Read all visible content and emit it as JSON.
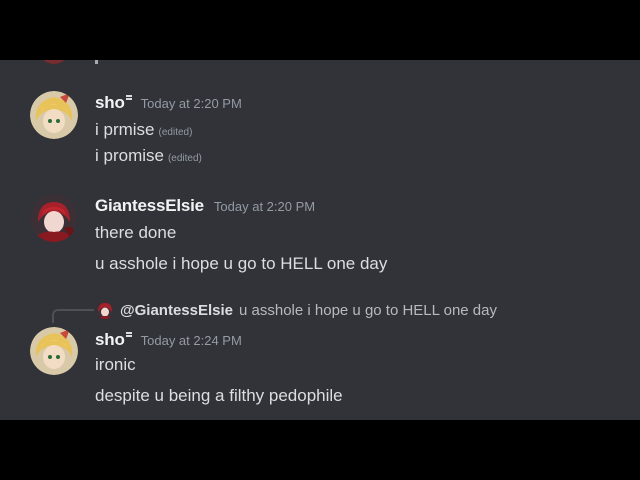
{
  "messages": [
    {
      "author": "sho",
      "timestamp": "Today at 2:20 PM",
      "lines": [
        {
          "text": "i prmise",
          "edited": "(edited)"
        },
        {
          "text": "i promise",
          "edited": "(edited)"
        }
      ]
    },
    {
      "author": "GiantessElsie",
      "timestamp": "Today at 2:20 PM",
      "lines": [
        {
          "text": "there done"
        },
        {
          "text": "u asshole i hope u go to HELL one day"
        }
      ]
    },
    {
      "reply": {
        "mention": "@GiantessElsie",
        "text": "u asshole i hope u go to HELL one day"
      },
      "author": "sho",
      "timestamp": "Today at 2:24 PM",
      "lines": [
        {
          "text": "ironic"
        },
        {
          "text": "despite u being a filthy pedophile"
        }
      ]
    }
  ],
  "colors": {
    "background": "#313338",
    "username": "#f2f3f5",
    "text": "#dbdee1",
    "muted": "#949ba4"
  }
}
